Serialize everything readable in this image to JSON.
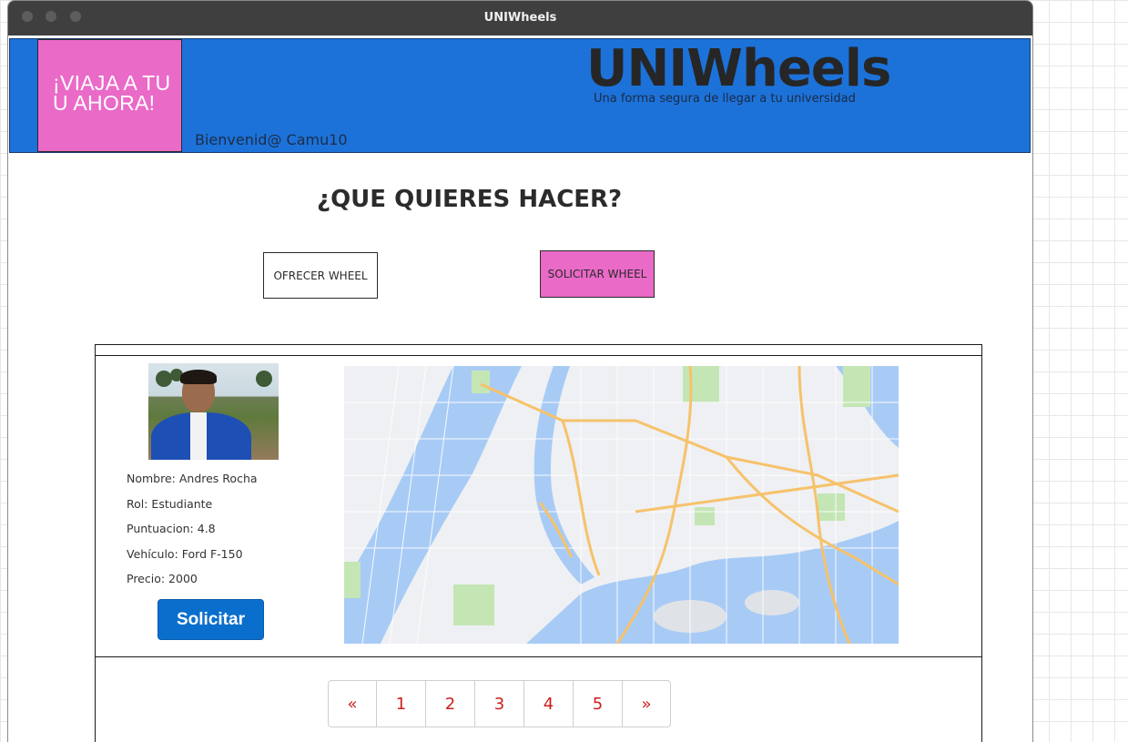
{
  "window": {
    "title": "UNIWheels"
  },
  "header": {
    "promo_line1": "¡VIAJA A TU",
    "promo_line2": "U AHORA!",
    "welcome": "Bienvenid@ Camu10",
    "brand": "UNIWheels",
    "tagline": "Una forma segura de llegar a tu universidad"
  },
  "main": {
    "question": "¿QUE QUIERES HACER?",
    "offer_label": "OFRECER WHEEL",
    "request_label": "SOLICITAR WHEEL"
  },
  "driver": {
    "name": "Nombre: Andres Rocha",
    "role": "Rol: Estudiante",
    "rating": "Puntuacion: 4.8",
    "vehicle": "Vehículo: Ford F-150",
    "price": "Precio: 2000",
    "request_button": "Solicitar"
  },
  "pagination": {
    "prev": "«",
    "pages": [
      "1",
      "2",
      "3",
      "4",
      "5"
    ],
    "next": "»"
  },
  "colors": {
    "header_blue": "#1c72d9",
    "accent_pink": "#ea6ac8",
    "button_blue": "#0a6fcc",
    "pagination_red": "#cc1f1f"
  }
}
